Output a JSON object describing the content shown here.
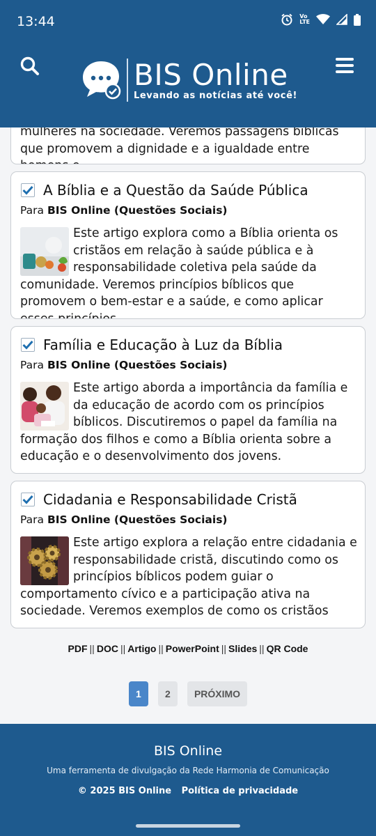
{
  "status_bar": {
    "time": "13:44",
    "icons": [
      "alarm-icon",
      "volte-icon",
      "wifi-icon",
      "signal-icon",
      "battery-icon"
    ],
    "volte_text": "Vo",
    "lte_text": "LTE"
  },
  "header": {
    "title": "BIS Online",
    "tagline": "Levando as notícias até você!",
    "background": "#1e5a8e"
  },
  "partial_card": {
    "text": "mulheres na sociedade. Veremos passagens bíblicas que promovem a dignidade e a igualdade entre homens e"
  },
  "articles": [
    {
      "title": "A Bíblia e a Questão da Saúde Pública",
      "meta_prefix": "Para",
      "meta_source": "BIS Online (Questões Sociais)",
      "body": "Este artigo explora como a Bíblia orienta os cristãos em relação à saúde pública e à responsabilidade coletiva pela saúde da comunidade. Veremos princípios bíblicos que promovem o bem-estar e a saúde, e como aplicar esses princípios",
      "checked": true
    },
    {
      "title": "Família e Educação à Luz da Bíblia",
      "meta_prefix": "Para",
      "meta_source": "BIS Online (Questões Sociais)",
      "body": "Este artigo aborda a importância da família e da educação de acordo com os princípios bíblicos. Discutiremos o papel da família na formação dos filhos e como a Bíblia orienta sobre a educação e o desenvolvimento dos jovens.",
      "checked": true
    },
    {
      "title": "Cidadania e Responsabilidade Cristã",
      "meta_prefix": "Para",
      "meta_source": "BIS Online (Questões Sociais)",
      "body": "Este artigo explora a relação entre cidadania e responsabilidade cristã, discutindo como os princípios bíblicos podem guiar o comportamento cívico e a participação ativa na sociedade. Veremos exemplos de como os cristãos",
      "checked": true
    }
  ],
  "formats": [
    "PDF",
    "DOC",
    "Artigo",
    "PowerPoint",
    "Slides",
    "QR Code"
  ],
  "format_separator": "||",
  "pagination": {
    "pages": [
      "1",
      "2"
    ],
    "current": "1",
    "next_label": "PRÓXIMO"
  },
  "footer": {
    "title": "BIS Online",
    "description": "Uma ferramenta de divulgação da Rede Harmonia de Comunicação",
    "copyright": "© 2025 BIS Online",
    "privacy_link": "Política de privacidade"
  },
  "colors": {
    "brand": "#1e5a8e",
    "accent": "#4a86c9",
    "check": "#1e6fb0"
  }
}
